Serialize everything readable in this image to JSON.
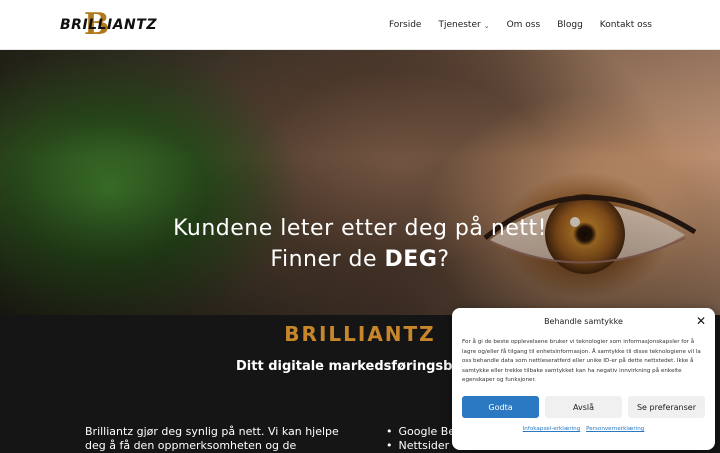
{
  "header": {
    "logo_letter": "B",
    "logo_text": "BRILLIANTZ",
    "nav": [
      {
        "label": "Forside"
      },
      {
        "label": "Tjenester",
        "icon": "chevron-down-icon"
      },
      {
        "label": "Om oss"
      },
      {
        "label": "Blogg"
      },
      {
        "label": "Kontakt oss"
      }
    ]
  },
  "hero": {
    "line1": "Kundene leter etter deg på nett!",
    "line2_prefix": "Finner de ",
    "line2_bold": "DEG",
    "line2_suffix": "?"
  },
  "section": {
    "title": "BRILLIANTZ",
    "tagline": "Ditt digitale markedsføringsb",
    "body": "Brilliantz gjør deg synlig på nett. Vi kan hjelpe deg å få den oppmerksomheten og de",
    "services": [
      "Google Be",
      "Nettsider"
    ]
  },
  "consent": {
    "title": "Behandle samtykke",
    "text": "For å gi de beste opplevelsene bruker vi teknologier som informasjonskapsler for å lagre og/eller få tilgang til enhetsinformasjon. Å samtykke til disse teknologiene vil la oss behandle data som nettleseratferd eller unike ID-er på dette nettstedet. Ikke å samtykke eller trekke tilbake samtykket kan ha negativ innvirkning på enkelte egenskaper og funksjoner.",
    "accept": "Godta",
    "deny": "Avslå",
    "preferences": "Se preferanser",
    "link1": "Infokapsel-erklæring",
    "link2": "Personvernerklæring"
  },
  "colors": {
    "brand_gold": "#c8862a",
    "accept_blue": "#2b79c2"
  }
}
